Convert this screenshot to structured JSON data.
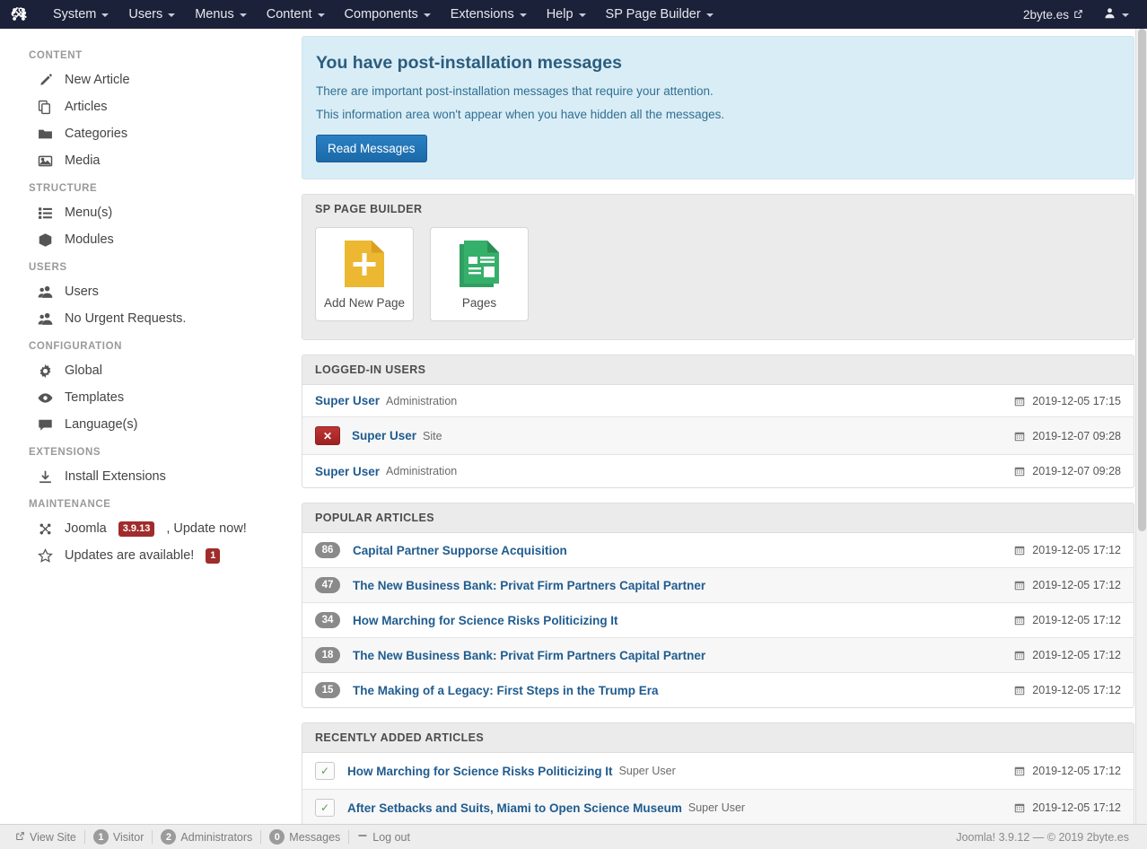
{
  "topbar": {
    "logo_icon": "joomla-logo-icon",
    "menu": [
      {
        "label": "System",
        "caret": true
      },
      {
        "label": "Users",
        "caret": true
      },
      {
        "label": "Menus",
        "caret": true
      },
      {
        "label": "Content",
        "caret": true
      },
      {
        "label": "Components",
        "caret": true
      },
      {
        "label": "Extensions",
        "caret": true
      },
      {
        "label": "Help",
        "caret": true
      },
      {
        "label": "SP Page Builder",
        "caret": true
      }
    ],
    "site_label": "2byte.es",
    "site_icon": "external-link-icon",
    "user_icon": "user-icon"
  },
  "sidebar": {
    "groups": [
      {
        "heading": "CONTENT",
        "items": [
          {
            "label": "New Article",
            "icon": "pencil-icon"
          },
          {
            "label": "Articles",
            "icon": "copy-icon"
          },
          {
            "label": "Categories",
            "icon": "folder-icon"
          },
          {
            "label": "Media",
            "icon": "image-icon"
          }
        ]
      },
      {
        "heading": "STRUCTURE",
        "items": [
          {
            "label": "Menu(s)",
            "icon": "list-icon"
          },
          {
            "label": "Modules",
            "icon": "cube-icon"
          }
        ]
      },
      {
        "heading": "USERS",
        "items": [
          {
            "label": "Users",
            "icon": "users-icon"
          },
          {
            "label": "No Urgent Requests.",
            "icon": "users-icon"
          }
        ]
      },
      {
        "heading": "CONFIGURATION",
        "items": [
          {
            "label": "Global",
            "icon": "gear-icon"
          },
          {
            "label": "Templates",
            "icon": "eye-icon"
          },
          {
            "label": "Language(s)",
            "icon": "comment-icon"
          }
        ]
      },
      {
        "heading": "EXTENSIONS",
        "items": [
          {
            "label": "Install Extensions",
            "icon": "download-icon"
          }
        ]
      },
      {
        "heading": "MAINTENANCE",
        "items": [
          {
            "label_pre": "Joomla",
            "badge": "3.9.13",
            "label_post": ", Update now!",
            "icon": "joomla-logo-icon"
          },
          {
            "label_pre": "Updates are available!",
            "badge": "1",
            "label_post": "",
            "icon": "star-icon"
          }
        ]
      }
    ]
  },
  "infobox": {
    "title": "You have post-installation messages",
    "line1": "There are important post-installation messages that require your attention.",
    "line2": "This information area won't appear when you have hidden all the messages.",
    "button": "Read Messages"
  },
  "page_builder": {
    "title": "SP PAGE BUILDER",
    "tiles": [
      {
        "label": "Add New Page",
        "icon": "new-page-icon",
        "color": "#ecb731"
      },
      {
        "label": "Pages",
        "icon": "pages-icon",
        "color": "#35b06a"
      }
    ]
  },
  "logged_in_users": {
    "title": "LOGGED-IN USERS",
    "rows": [
      {
        "has_logout": false,
        "name": "Super User",
        "context": "Administration",
        "date": "2019-12-05 17:15"
      },
      {
        "has_logout": true,
        "logout_icon": "x-icon",
        "name": "Super User",
        "context": "Site",
        "date": "2019-12-07 09:28"
      },
      {
        "has_logout": false,
        "name": "Super User",
        "context": "Administration",
        "date": "2019-12-07 09:28"
      }
    ]
  },
  "popular_articles": {
    "title": "POPULAR ARTICLES",
    "rows": [
      {
        "hits": "86",
        "title": "Capital Partner Supporse Acquisition",
        "date": "2019-12-05 17:12"
      },
      {
        "hits": "47",
        "title": "The New Business Bank: Privat Firm Partners Capital Partner",
        "date": "2019-12-05 17:12"
      },
      {
        "hits": "34",
        "title": "How Marching for Science Risks Politicizing It",
        "date": "2019-12-05 17:12"
      },
      {
        "hits": "18",
        "title": "The New Business Bank: Privat Firm Partners Capital Partner",
        "date": "2019-12-05 17:12"
      },
      {
        "hits": "15",
        "title": "The Making of a Legacy: First Steps in the Trump Era",
        "date": "2019-12-05 17:12"
      }
    ]
  },
  "recently_added": {
    "title": "RECENTLY ADDED ARTICLES",
    "rows": [
      {
        "state_icon": "check-icon",
        "title": "How Marching for Science Risks Politicizing It",
        "author": "Super User",
        "date": "2019-12-05 17:12"
      },
      {
        "state_icon": "check-icon",
        "title": "After Setbacks and Suits, Miami to Open Science Museum",
        "author": "Super User",
        "date": "2019-12-05 17:12"
      }
    ]
  },
  "statusbar": {
    "view_site": "View Site",
    "view_site_icon": "external-link-icon",
    "visitors_count": "1",
    "visitors_label": "Visitor",
    "admins_count": "2",
    "admins_label": "Administrators",
    "messages_count": "0",
    "messages_label": "Messages",
    "logout_label": "Log out",
    "logout_icon": "minus-icon",
    "copyright": "Joomla! 3.9.12  —  © 2019 2byte.es"
  },
  "colors": {
    "nav_bg": "#1b2138",
    "info_bg": "#d9edf7",
    "link": "#205c8f",
    "badge_red": "#a02c2c",
    "accent_blue": "#2072b5"
  }
}
